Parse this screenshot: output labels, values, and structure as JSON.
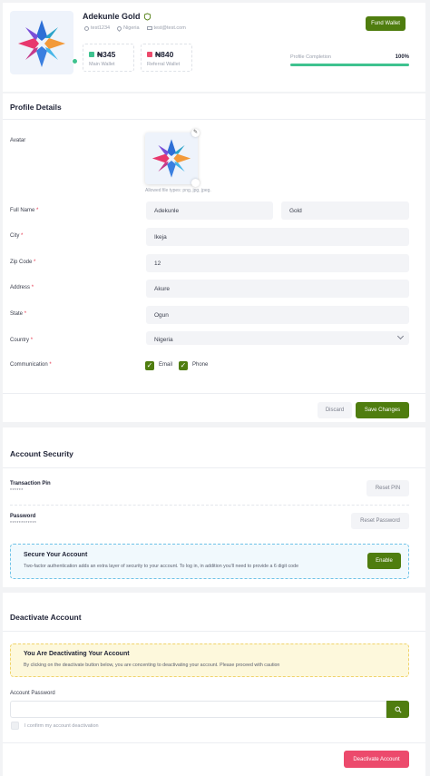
{
  "profile": {
    "name": "Adekunle Gold",
    "username": "test1234",
    "location": "Nigeria",
    "email": "test@test.com",
    "fund_wallet_label": "Fund Wallet",
    "main_wallet_amount": "₦345",
    "main_wallet_label": "Main Wallet",
    "referral_wallet_amount": "₦840",
    "referral_wallet_label": "Referral Wallet",
    "completion_label": "Profile Completion",
    "completion_value": "100%",
    "completion_fraction": 1.0
  },
  "details": {
    "title": "Profile Details",
    "avatar_label": "Avatar",
    "avatar_hint": "Allowed file types: png, jpg, jpeg.",
    "full_name_label": "Full Name",
    "first_name": "Adekunle",
    "last_name": "Gold",
    "city_label": "City",
    "city": "Ikeja",
    "zip_label": "Zip Code",
    "zip": "12",
    "address_label": "Address",
    "address": "Akure",
    "state_label": "State",
    "state": "Ogun",
    "country_label": "Country",
    "country": "Nigeria",
    "communication_label": "Communication",
    "email_option": "Email",
    "phone_option": "Phone",
    "required_mark": "*",
    "discard_label": "Discard",
    "save_label": "Save Changes"
  },
  "security": {
    "title": "Account Security",
    "pin_label": "Transaction Pin",
    "pin_mask": "******",
    "reset_pin_label": "Reset PIN",
    "password_label": "Password",
    "password_mask": "************",
    "reset_password_label": "Reset Password",
    "secure_title": "Secure Your Account",
    "secure_text": "Two-factor authentication adds an extra layer of security to your account. To log in, in addition you'll need to provide a 6 digit code",
    "enable_label": "Enable"
  },
  "deactivate": {
    "title": "Deactivate Account",
    "warning_title": "You Are Deactivating Your Account",
    "warning_text": "By clicking on the deactivate button below, you are concenting to deactivating your account. Please proceed with caution",
    "password_label": "Account Password",
    "confirm_label": "I confirm my account deactivation",
    "button_label": "Deactivate Account"
  },
  "colors": {
    "accent": "#4f7d0f",
    "danger": "#ec4a6c",
    "progress": "#3ec28f",
    "info_border": "#6fc3e8",
    "warning_bg": "#fdf8dc"
  },
  "icons": {
    "verified": "shield-check-icon",
    "user": "user-icon",
    "location": "map-pin-icon",
    "email": "envelope-icon",
    "wallet": "wallet-icon",
    "edit": "pencil-icon",
    "dropdown": "chevron-down-icon",
    "search": "search-icon"
  }
}
